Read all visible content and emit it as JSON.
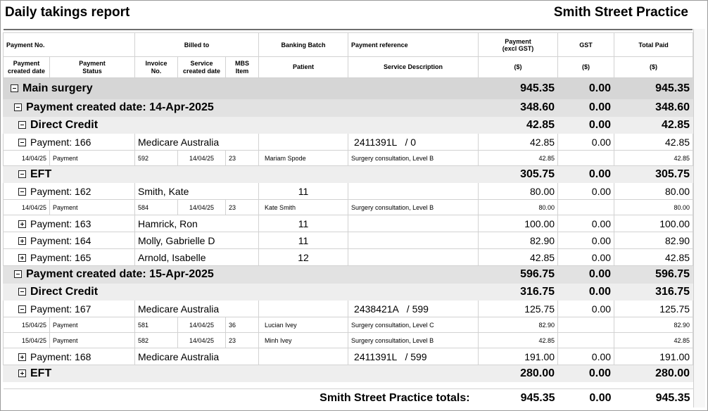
{
  "report": {
    "title": "Daily takings report",
    "practice": "Smith Street Practice"
  },
  "headers": {
    "row1": {
      "payment_no": "Payment No.",
      "billed_to": "Billed to",
      "banking_batch": "Banking Batch",
      "payment_reference": "Payment reference",
      "payment_excl_gst_1": "Payment",
      "payment_excl_gst_2": "(excl GST)",
      "gst": "GST",
      "total_paid": "Total Paid"
    },
    "row2": {
      "payment_created_date_1": "Payment",
      "payment_created_date_2": "created date",
      "payment_status_1": "Payment",
      "payment_status_2": "Status",
      "invoice_no_1": "Invoice",
      "invoice_no_2": "No.",
      "service_created_date_1": "Service",
      "service_created_date_2": "created date",
      "mbs_item_1": "MBS",
      "mbs_item_2": "Item",
      "patient": "Patient",
      "service_description": "Service Description",
      "unit_payment": "($)",
      "unit_gst": "($)",
      "unit_total": "($)"
    }
  },
  "rows": {
    "main": {
      "label": "Main surgery",
      "payment": "945.35",
      "gst": "0.00",
      "total": "945.35"
    },
    "date1": {
      "label": "Payment created date: 14-Apr-2025",
      "payment": "348.60",
      "gst": "0.00",
      "total": "348.60"
    },
    "dc1": {
      "label": "Direct Credit",
      "payment": "42.85",
      "gst": "0.00",
      "total": "42.85"
    },
    "p166": {
      "label": "Payment: 166",
      "billed": "Medicare Australia",
      "batch": "",
      "ref": "2411391L   / 0",
      "payment": "42.85",
      "gst": "0.00",
      "total": "42.85"
    },
    "d166": {
      "date": "14/04/25",
      "status": "Payment",
      "invoice": "592",
      "service_date": "14/04/25",
      "mbs": "23",
      "patient": "Mariam Spode",
      "desc": "Surgery consultation, Level B",
      "payment": "42.85",
      "total": "42.85"
    },
    "eft1": {
      "label": "EFT",
      "payment": "305.75",
      "gst": "0.00",
      "total": "305.75"
    },
    "p162": {
      "label": "Payment: 162",
      "billed": "Smith, Kate",
      "batch": "11",
      "ref": "",
      "payment": "80.00",
      "gst": "0.00",
      "total": "80.00"
    },
    "d162": {
      "date": "14/04/25",
      "status": "Payment",
      "invoice": "584",
      "service_date": "14/04/25",
      "mbs": "23",
      "patient": "Kate Smith",
      "desc": "Surgery consultation, Level B",
      "payment": "80.00",
      "total": "80.00"
    },
    "p163": {
      "label": "Payment: 163",
      "billed": "Hamrick, Ron",
      "batch": "11",
      "ref": "",
      "payment": "100.00",
      "gst": "0.00",
      "total": "100.00"
    },
    "p164": {
      "label": "Payment: 164",
      "billed": "Molly, Gabrielle D",
      "batch": "11",
      "ref": "",
      "payment": "82.90",
      "gst": "0.00",
      "total": "82.90"
    },
    "p165": {
      "label": "Payment: 165",
      "billed": "Arnold, Isabelle",
      "batch": "12",
      "ref": "",
      "payment": "42.85",
      "gst": "0.00",
      "total": "42.85"
    },
    "date2": {
      "label": "Payment created date: 15-Apr-2025",
      "payment": "596.75",
      "gst": "0.00",
      "total": "596.75"
    },
    "dc2": {
      "label": "Direct Credit",
      "payment": "316.75",
      "gst": "0.00",
      "total": "316.75"
    },
    "p167": {
      "label": "Payment: 167",
      "billed": "Medicare Australia",
      "batch": "",
      "ref": "2438421A   / 599",
      "payment": "125.75",
      "gst": "0.00",
      "total": "125.75"
    },
    "d167a": {
      "date": "15/04/25",
      "status": "Payment",
      "invoice": "581",
      "service_date": "14/04/25",
      "mbs": "36",
      "patient": "Lucian Ivey",
      "desc": "Surgery consultation, Level C",
      "payment": "82.90",
      "total": "82.90"
    },
    "d167b": {
      "date": "15/04/25",
      "status": "Payment",
      "invoice": "582",
      "service_date": "14/04/25",
      "mbs": "23",
      "patient": "Minh Ivey",
      "desc": "Surgery consultation, Level B",
      "payment": "42.85",
      "total": "42.85"
    },
    "p168": {
      "label": "Payment: 168",
      "billed": "Medicare Australia",
      "batch": "",
      "ref": "2411391L   / 599",
      "payment": "191.00",
      "gst": "0.00",
      "total": "191.00"
    },
    "eft2": {
      "label": "EFT",
      "payment": "280.00",
      "gst": "0.00",
      "total": "280.00"
    }
  },
  "totals": {
    "label": "Smith Street Practice totals:",
    "payment": "945.35",
    "gst": "0.00",
    "total": "945.35"
  },
  "icons": {
    "expanded": "collapse-box-icon",
    "collapsed": "expand-box-icon"
  },
  "colors": {
    "group1_bg": "#d6d6d6",
    "group2_bg": "#e2e2e2",
    "group3_bg": "#eeeeee",
    "grid": "#d2d2d2"
  }
}
